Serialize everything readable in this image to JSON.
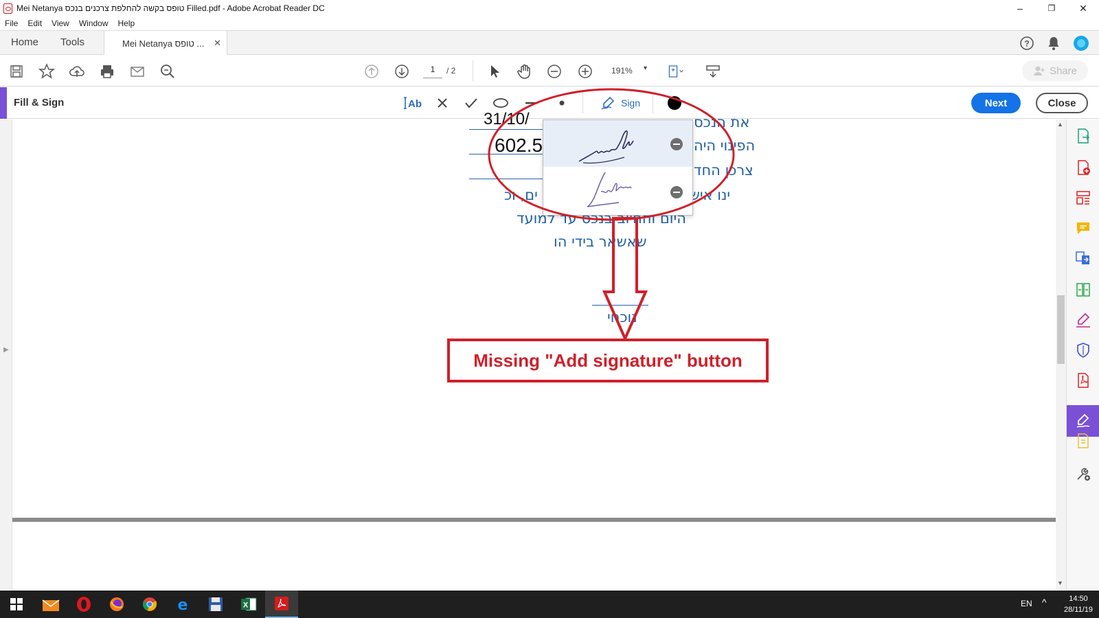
{
  "window": {
    "title": "Mei Netanya טופס בקשה להחלפת צרכנים בנכס Filled.pdf - Adobe Acrobat Reader DC",
    "minimize": "–",
    "maximize": "❐",
    "close": "✕"
  },
  "menu": [
    "File",
    "Edit",
    "View",
    "Window",
    "Help"
  ],
  "tabs": {
    "home": "Home",
    "tools": "Tools",
    "document": "Mei Netanya טופס ...",
    "document_close": "✕"
  },
  "toolbar": {
    "page_current": "1",
    "page_total": "/ 2",
    "zoom": "191%",
    "zoom_caret": "▾",
    "share": "Share"
  },
  "fill_sign": {
    "label": "Fill & Sign",
    "sign": "Sign",
    "next": "Next",
    "close": "Close",
    "color": "#000000"
  },
  "document_text": {
    "line1": "את הנכס",
    "line1_left": "3‎1/10/",
    "line2": "הפינוי היה",
    "line2_value": "602.5",
    "line3": "צרכן החד",
    "line4": "ינו איש",
    "line4b": "ים, וכ",
    "line5": "היום והחיוב בנכס עד למועד",
    "line6": "שאשאר בידי הו",
    "line7": "נוכחי"
  },
  "annotation": {
    "callout": "Missing \"Add signature\" button",
    "color": "#d0202a"
  },
  "taskbar": {
    "lang": "EN",
    "caret": "^",
    "time": "14:50",
    "date": "28/11/19"
  },
  "colors": {
    "accent_purple": "#7a50d6",
    "primary_blue": "#1473e6",
    "doc_text_blue": "#1e5fa3"
  }
}
